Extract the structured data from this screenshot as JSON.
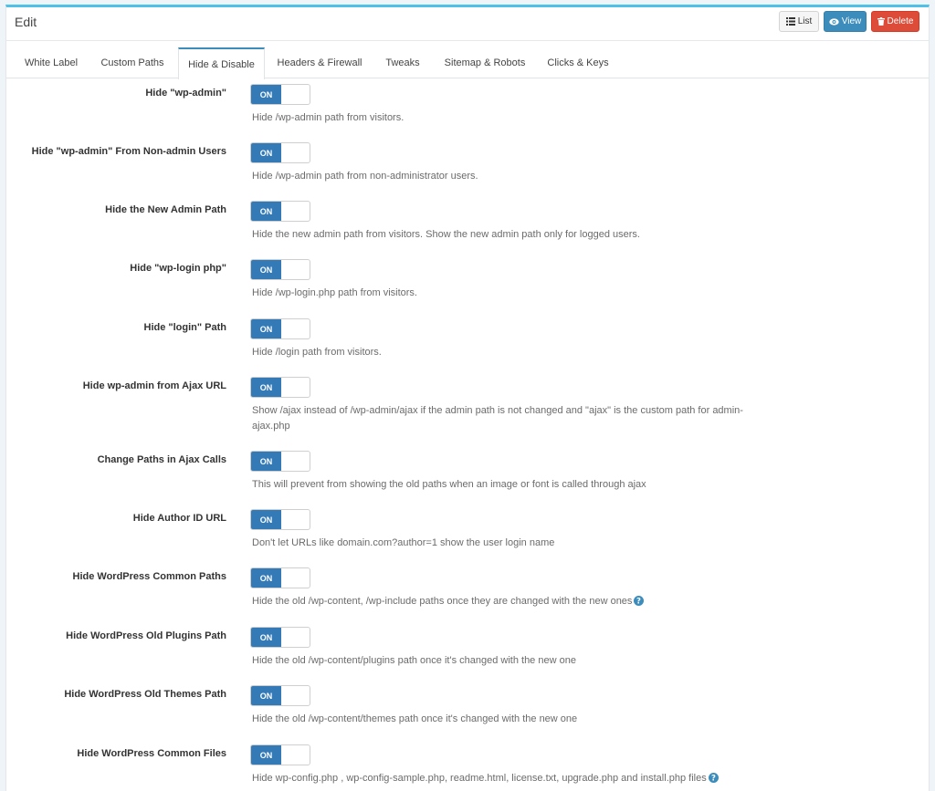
{
  "header": {
    "title": "Edit",
    "buttons": {
      "list": "List",
      "view": "View",
      "delete": "Delete"
    }
  },
  "tabs": [
    {
      "label": "White Label"
    },
    {
      "label": "Custom Paths"
    },
    {
      "label": "Hide & Disable",
      "active": true
    },
    {
      "label": "Headers & Firewall"
    },
    {
      "label": "Tweaks"
    },
    {
      "label": "Sitemap & Robots"
    },
    {
      "label": "Clicks & Keys"
    }
  ],
  "settings": [
    {
      "label": "Hide \"wp-admin\"",
      "toggle": "ON",
      "description": "Hide /wp-admin path from visitors."
    },
    {
      "label": "Hide \"wp-admin\" From Non-admin Users",
      "toggle": "ON",
      "description": "Hide /wp-admin path from non-administrator users."
    },
    {
      "label": "Hide the New Admin Path",
      "toggle": "ON",
      "description": "Hide the new admin path from visitors. Show the new admin path only for logged users."
    },
    {
      "label": "Hide \"wp-login php\"",
      "toggle": "ON",
      "description": "Hide /wp-login.php path from visitors."
    },
    {
      "label": "Hide \"login\" Path",
      "toggle": "ON",
      "description": "Hide /login path from visitors."
    },
    {
      "label": "Hide wp-admin from Ajax URL",
      "toggle": "ON",
      "description": "Show /ajax instead of /wp-admin/ajax if the admin path is not changed and \"ajax\" is the custom path for admin-ajax.php"
    },
    {
      "label": "Change Paths in Ajax Calls",
      "toggle": "ON",
      "description": "This will prevent from showing the old paths when an image or font is called through ajax"
    },
    {
      "label": "Hide Author ID URL",
      "toggle": "ON",
      "description": "Don't let URLs like domain.com?author=1 show the user login name"
    },
    {
      "label": "Hide WordPress Common Paths",
      "toggle": "ON",
      "description": "Hide the old /wp-content, /wp-include paths once they are changed with the new ones",
      "help": true
    },
    {
      "label": "Hide WordPress Old Plugins Path",
      "toggle": "ON",
      "description": "Hide the old /wp-content/plugins path once it's changed with the new one"
    },
    {
      "label": "Hide WordPress Old Themes Path",
      "toggle": "ON",
      "description": "Hide the old /wp-content/themes path once it's changed with the new one"
    },
    {
      "label": "Hide WordPress Common Files",
      "toggle": "ON",
      "description": "Hide wp-config.php , wp-config-sample.php, readme.html, license.txt, upgrade.php and install.php files",
      "help": true
    }
  ],
  "colors": {
    "accent": "#3c8dbc",
    "toggle_on": "#337ab7",
    "danger": "#dd4b39",
    "top_border": "#4fc1e9"
  }
}
